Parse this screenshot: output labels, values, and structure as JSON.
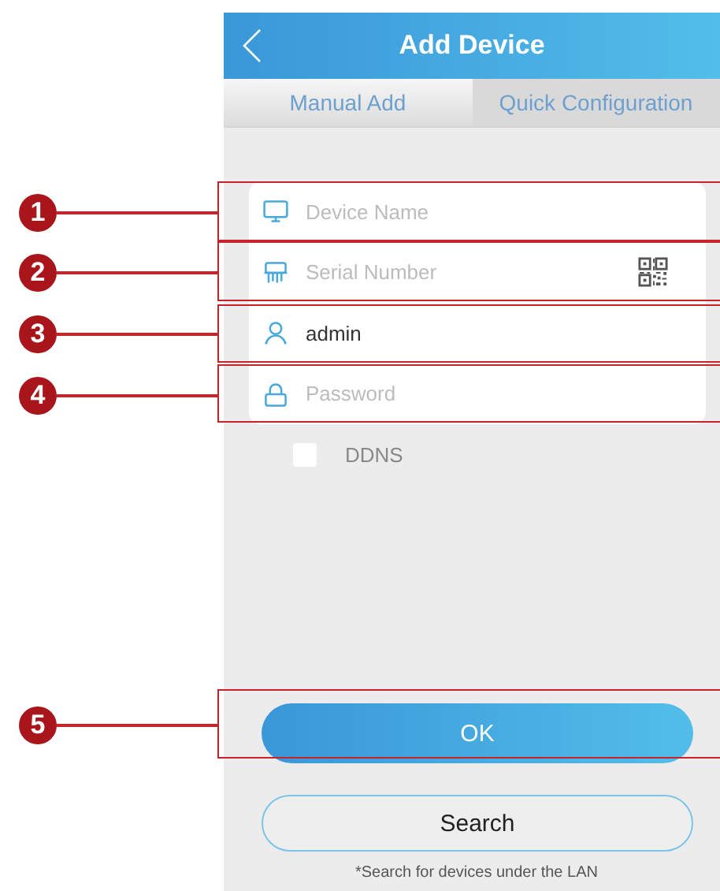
{
  "header": {
    "title": "Add Device"
  },
  "tabs": [
    {
      "label": "Manual Add",
      "selected": true
    },
    {
      "label": "Quick Configuration",
      "selected": false
    }
  ],
  "fields": [
    {
      "kind": "name",
      "placeholder": "Device Name"
    },
    {
      "kind": "serial",
      "placeholder": "Serial Number"
    },
    {
      "kind": "user",
      "value": "admin"
    },
    {
      "kind": "password",
      "placeholder": "Password"
    }
  ],
  "ddns": {
    "label": "DDNS",
    "checked": false
  },
  "ok_button": "OK",
  "search_button": "Search",
  "search_note": "*Search for devices under the LAN",
  "callouts": [
    {
      "number": "1"
    },
    {
      "number": "2"
    },
    {
      "number": "3"
    },
    {
      "number": "4"
    },
    {
      "number": "5"
    }
  ]
}
